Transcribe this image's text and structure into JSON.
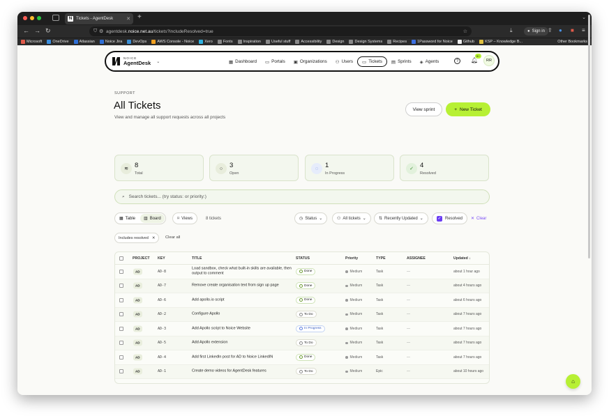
{
  "browser": {
    "tab_title": "Tickets - AgentDesk",
    "url_prefix": "agentdesk.",
    "url_domain": "noice.net.au",
    "url_path": "/tickets?includeResolved=true",
    "signin_label": "Sign in",
    "bookmarks": [
      "Microsoft",
      "OneDrive",
      "Atlassian",
      "Noice Jira",
      "DevOps",
      "AWS Console - Noice",
      "Xero",
      "Fonts",
      "Inspiration",
      "Useful stuff",
      "Accessibility",
      "Design",
      "Design Systems",
      "Recipes",
      "1Password for Noice",
      "Github",
      "KSP – Knowledge B..."
    ],
    "other_bookmarks": "Other Bookmarks"
  },
  "brand": {
    "small": "NOICE",
    "big": "AgentDesk"
  },
  "nav": {
    "items": [
      {
        "label": "Dashboard",
        "icon": "dashboard-icon"
      },
      {
        "label": "Portals",
        "icon": "portals-icon"
      },
      {
        "label": "Organizations",
        "icon": "organizations-icon"
      },
      {
        "label": "Users",
        "icon": "users-icon"
      },
      {
        "label": "Tickets",
        "icon": "tickets-icon",
        "active": true
      },
      {
        "label": "Sprints",
        "icon": "sprints-icon"
      },
      {
        "label": "Agents",
        "icon": "agents-icon"
      }
    ],
    "notif_count": "9+",
    "avatar_initials": "RR"
  },
  "header": {
    "kicker": "SUPPORT",
    "title": "All Tickets",
    "subtitle": "View and manage all support requests across all projects",
    "view_sprint": "View sprint",
    "new_ticket": "New Ticket"
  },
  "stats": [
    {
      "value": "8",
      "label": "Total"
    },
    {
      "value": "3",
      "label": "Open"
    },
    {
      "value": "1",
      "label": "In Progress"
    },
    {
      "value": "4",
      "label": "Resolved"
    }
  ],
  "search": {
    "placeholder": "Search tickets... (try status: or priority:)"
  },
  "toolbar": {
    "table": "Table",
    "board": "Board",
    "views": "Views",
    "count": "8 tickets",
    "status": "Status",
    "all_tickets": "All tickets",
    "sort": "Recently Updated",
    "resolved": "Resolved",
    "clear": "Clear"
  },
  "filters": {
    "chip": "Includes resolved",
    "clear_all": "Clear all"
  },
  "table": {
    "headers": [
      "PROJECT",
      "KEY",
      "TITLE",
      "STATUS",
      "Priority",
      "TYPE",
      "ASSIGNEE",
      "Updated"
    ],
    "rows": [
      {
        "project": "AD",
        "key": "AD-8",
        "title": "Load sandbox, check what built-in skills are available, then output to comment",
        "status": "Done",
        "priority": "Medium",
        "type": "Task",
        "assignee": "—",
        "updated": "about 1 hour ago"
      },
      {
        "project": "AD",
        "key": "AD-7",
        "title": "Remove create organisation text from sign up page",
        "status": "Done",
        "priority": "Medium",
        "type": "Task",
        "assignee": "—",
        "updated": "about 4 hours ago"
      },
      {
        "project": "AD",
        "key": "AD-6",
        "title": "Add apollo.io script",
        "status": "Done",
        "priority": "Medium",
        "type": "Task",
        "assignee": "—",
        "updated": "about 6 hours ago"
      },
      {
        "project": "AD",
        "key": "AD-2",
        "title": "Configure Apollo",
        "status": "To Do",
        "priority": "Medium",
        "type": "Task",
        "assignee": "—",
        "updated": "about 7 hours ago"
      },
      {
        "project": "AD",
        "key": "AD-3",
        "title": "Add Apollo script to Noice Website",
        "status": "In Progress",
        "priority": "Medium",
        "type": "Task",
        "assignee": "—",
        "updated": "about 7 hours ago"
      },
      {
        "project": "AD",
        "key": "AD-5",
        "title": "Add Apollo extension",
        "status": "To Do",
        "priority": "Medium",
        "type": "Task",
        "assignee": "—",
        "updated": "about 7 hours ago"
      },
      {
        "project": "AD",
        "key": "AD-4",
        "title": "Add first LinkedIn post for AD to Noice LinkedIN",
        "status": "Done",
        "priority": "Medium",
        "type": "Task",
        "assignee": "—",
        "updated": "about 7 hours ago"
      },
      {
        "project": "AD",
        "key": "AD-1",
        "title": "Create demo videos for AgentDesk features",
        "status": "To Do",
        "priority": "Medium",
        "type": "Epic",
        "assignee": "—",
        "updated": "about 10 hours ago"
      }
    ]
  },
  "colors": {
    "accent": "#b7f034",
    "purple": "#6b3df2"
  }
}
